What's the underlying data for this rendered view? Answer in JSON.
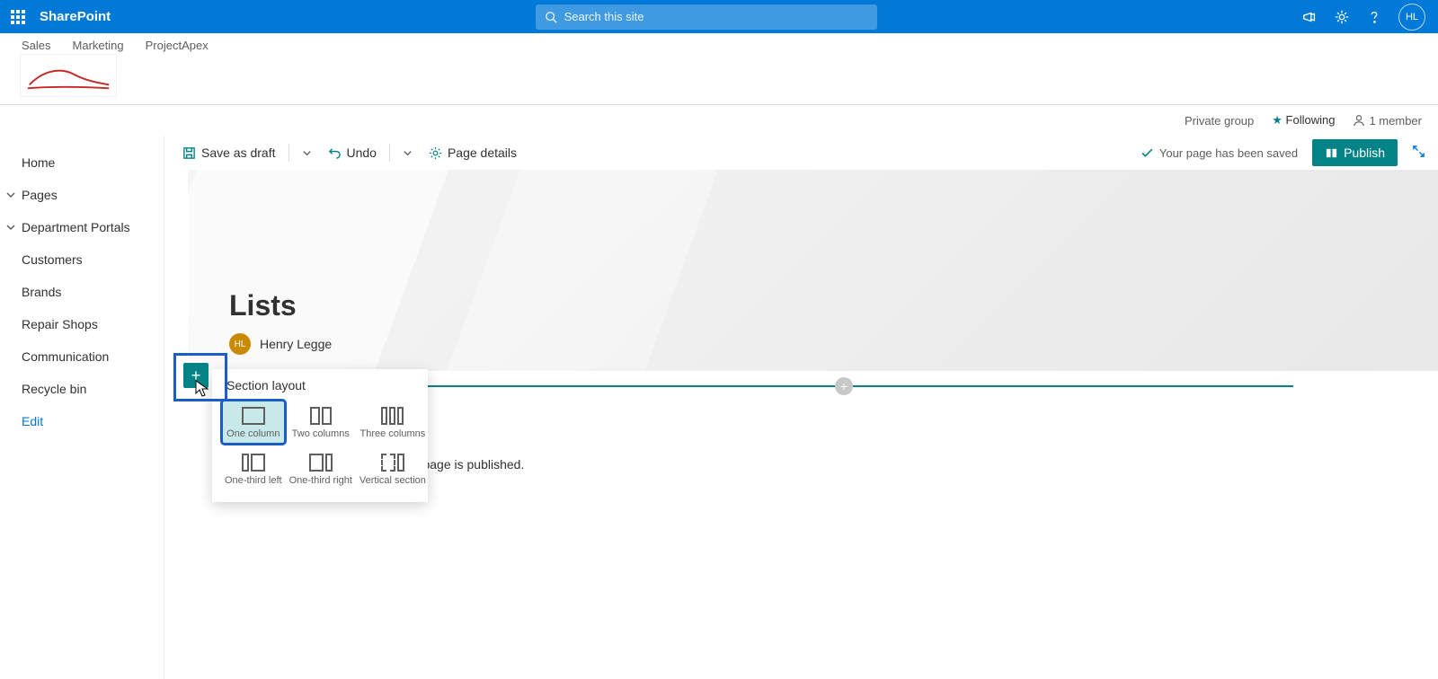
{
  "suite": {
    "brand": "SharePoint",
    "search_placeholder": "Search this site",
    "avatar_initials": "HL"
  },
  "hub_links": [
    "Sales",
    "Marketing",
    "ProjectApex"
  ],
  "site_info": {
    "privacy": "Private group",
    "following": "Following",
    "members": "1 member"
  },
  "leftnav": {
    "items": [
      {
        "label": "Home",
        "chevron": false
      },
      {
        "label": "Pages",
        "chevron": true
      },
      {
        "label": "Department Portals",
        "chevron": true
      },
      {
        "label": "Customers",
        "chevron": false
      },
      {
        "label": "Brands",
        "chevron": false
      },
      {
        "label": "Repair Shops",
        "chevron": false
      },
      {
        "label": "Communication",
        "chevron": false
      },
      {
        "label": "Recycle bin",
        "chevron": false
      }
    ],
    "edit": "Edit"
  },
  "cmdbar": {
    "save_draft": "Save as draft",
    "undo": "Undo",
    "page_details": "Page details",
    "saved_msg": "Your page has been saved",
    "publish": "Publish"
  },
  "hero": {
    "title": "Lists",
    "author_initials": "HL",
    "author_name": "Henry Legge"
  },
  "placeholder": "he page is published.",
  "popover": {
    "title": "Section layout",
    "options": [
      "One column",
      "Two columns",
      "Three columns",
      "One-third left",
      "One-third right",
      "Vertical section"
    ]
  }
}
